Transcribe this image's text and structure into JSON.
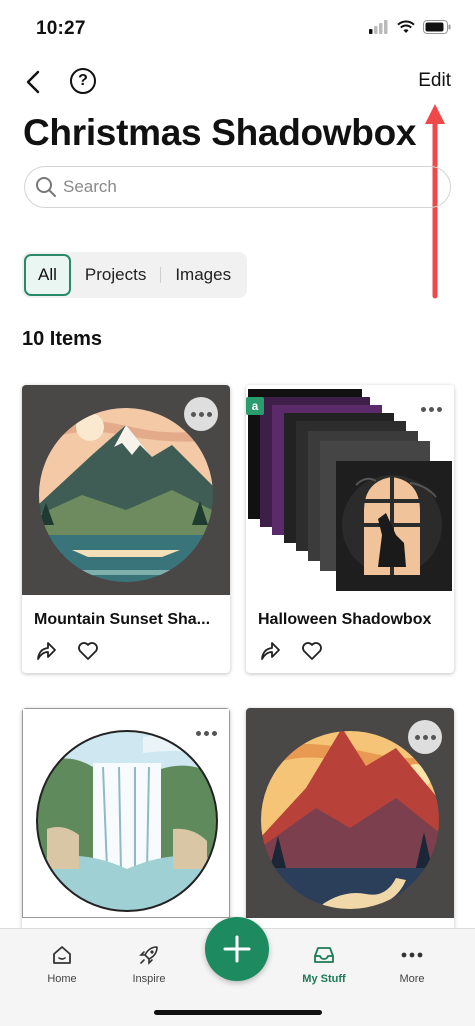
{
  "status_bar": {
    "time": "10:27"
  },
  "nav": {
    "edit_label": "Edit",
    "help_glyph": "?"
  },
  "page": {
    "title": "Christmas Shadowbox"
  },
  "search": {
    "placeholder": "Search"
  },
  "filters": [
    {
      "label": "All",
      "active": true
    },
    {
      "label": "Projects",
      "active": false
    },
    {
      "label": "Images",
      "active": false
    }
  ],
  "items_count": "10 Items",
  "cards": [
    {
      "title": "Mountain Sunset Sha...",
      "image": "mountain-sunset-art"
    },
    {
      "title": "Halloween Shadowbox",
      "image": "halloween-shadowbox-art",
      "badge": "a"
    },
    {
      "title": "",
      "image": "waterfall-art"
    },
    {
      "title": "",
      "image": "red-mountain-art"
    }
  ],
  "tabbar": {
    "fab_icon": "plus-icon",
    "tabs": [
      {
        "label": "Home",
        "icon": "home-icon",
        "active": false
      },
      {
        "label": "Inspire",
        "icon": "rocket-icon",
        "active": false
      },
      {
        "label": "My Stuff",
        "icon": "inbox-icon",
        "active": true
      },
      {
        "label": "More",
        "icon": "more-dots-icon",
        "active": false
      }
    ]
  },
  "colors": {
    "accent": "#1d8a5f",
    "annotation": "#f04848"
  }
}
